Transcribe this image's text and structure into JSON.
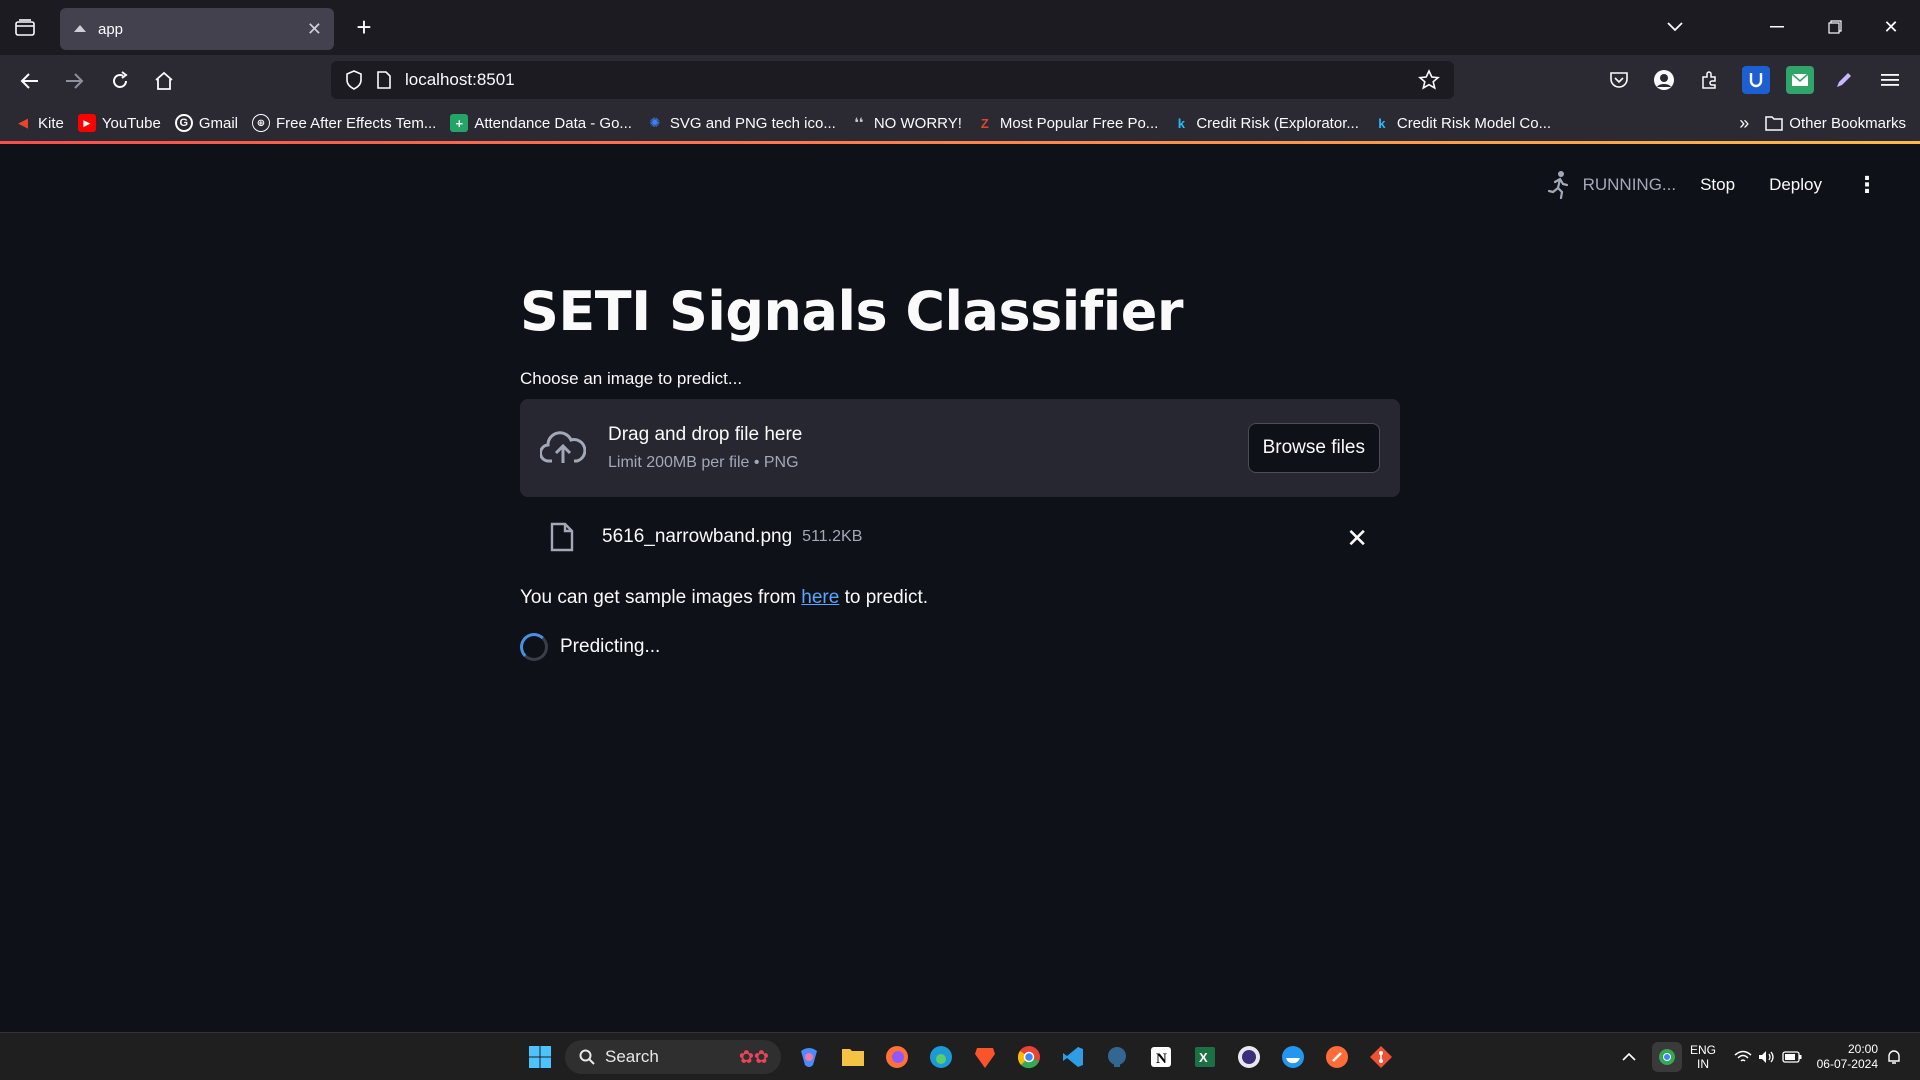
{
  "browser": {
    "tab_title": "app",
    "url": "localhost:8501",
    "bookmarks": [
      {
        "label": "Kite",
        "color": "#e8452c"
      },
      {
        "label": "YouTube",
        "color": "#ff0000"
      },
      {
        "label": "Gmail",
        "color": "#ffffff"
      },
      {
        "label": "Free After Effects Tem...",
        "color": "#dddddd"
      },
      {
        "label": "Attendance Data - Go...",
        "color": "#23a566"
      },
      {
        "label": "SVG and PNG tech ico...",
        "color": "#3b82f6"
      },
      {
        "label": "NO WORRY!",
        "color": "#aaaaaa"
      },
      {
        "label": "Most Popular Free Po...",
        "color": "#e0452c"
      },
      {
        "label": "Credit Risk (Explorator...",
        "color": "#20beff"
      },
      {
        "label": "Credit Risk Model Co...",
        "color": "#20beff"
      }
    ],
    "other_bookmarks": "Other Bookmarks"
  },
  "app": {
    "status": "RUNNING...",
    "stop_label": "Stop",
    "deploy_label": "Deploy",
    "title": "SETI Signals Classifier",
    "uploader_label": "Choose an image to predict...",
    "dropzone_title": "Drag and drop file here",
    "dropzone_limit": "Limit 200MB per file • PNG",
    "browse_label": "Browse files",
    "file_name": "5616_narrowband.png",
    "file_size": "511.2KB",
    "info_prefix": "You can get sample images from ",
    "info_link": "here",
    "info_suffix": " to predict.",
    "spinner_text": "Predicting..."
  },
  "taskbar": {
    "search_label": "Search",
    "lang_top": "ENG",
    "lang_bottom": "IN",
    "time": "20:00",
    "date": "06-07-2024"
  }
}
